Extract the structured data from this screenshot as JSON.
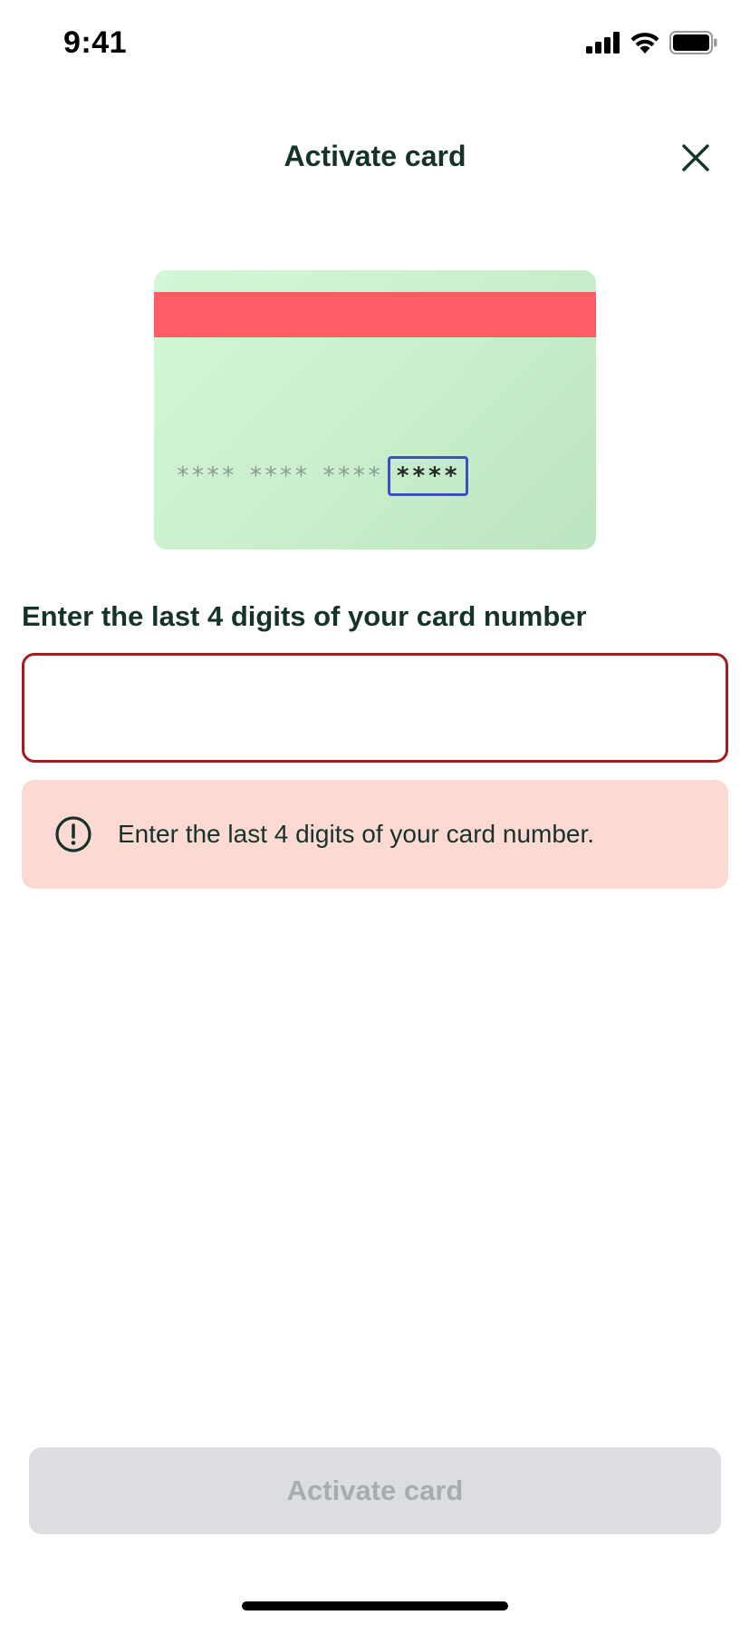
{
  "status_bar": {
    "time": "9:41",
    "icons": [
      "cellular-signal-icon",
      "wifi-icon",
      "battery-icon"
    ]
  },
  "header": {
    "title": "Activate card",
    "close_icon": "close-icon"
  },
  "card_illustration": {
    "number_groups": [
      "****",
      "****",
      "****"
    ],
    "highlighted_group": "****",
    "colors": {
      "card_background": "#cdf3d0",
      "stripe": "#ff5c66",
      "highlight_border": "#3e4dc9"
    }
  },
  "form": {
    "label": "Enter the last 4 digits of your card number",
    "input_value": "",
    "input_placeholder": "",
    "error_message": "Enter the last 4 digits of your card number.",
    "error_icon": "alert-circle-icon"
  },
  "footer": {
    "button_label": "Activate card",
    "button_enabled": false
  },
  "colors": {
    "text_primary": "#16332b",
    "error_border": "#a51c1c",
    "error_background": "#fdd9d4",
    "disabled_button_bg": "#dcdde0",
    "disabled_button_text": "#a7abb2"
  }
}
